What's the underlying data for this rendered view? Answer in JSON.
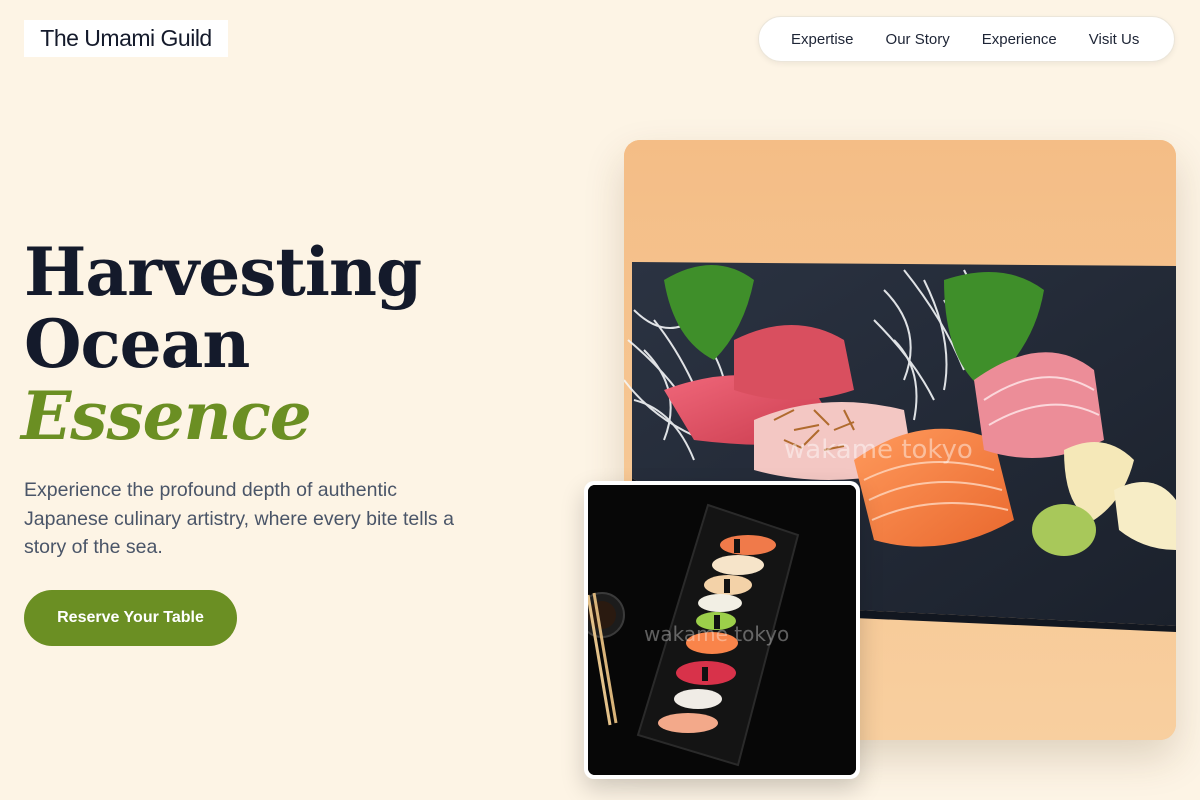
{
  "brand": {
    "name": "The Umami Guild"
  },
  "nav": {
    "items": [
      {
        "label": "Expertise"
      },
      {
        "label": "Our Story"
      },
      {
        "label": "Experience"
      },
      {
        "label": "Visit Us"
      }
    ]
  },
  "hero": {
    "headline_line1": "Harvesting",
    "headline_line2": "Ocean",
    "headline_accent": "Essence",
    "subtitle": "Experience the profound depth of authentic Japanese culinary artistry, where every bite tells a story of the sea.",
    "cta_label": "Reserve Your Table"
  },
  "images": {
    "main_watermark": "wakame tokyo",
    "secondary_watermark": "wakame tokyo"
  },
  "colors": {
    "background": "#fdf4e5",
    "accent": "#6b8f23",
    "text": "#141a2b",
    "muted": "#4a5568"
  }
}
